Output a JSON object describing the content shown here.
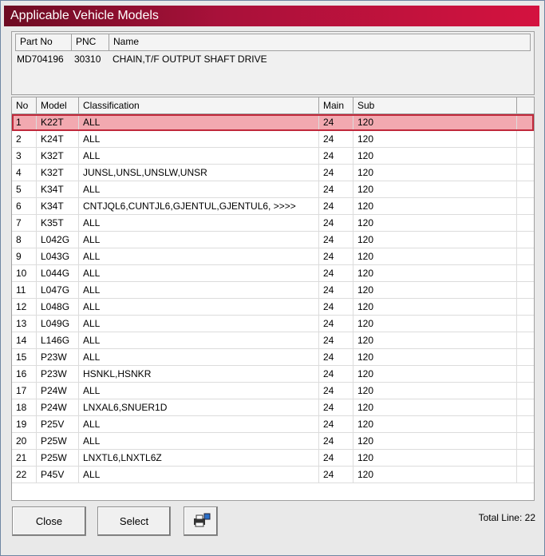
{
  "window": {
    "title": "Applicable Vehicle Models"
  },
  "part_panel": {
    "headers": [
      "Part No",
      "PNC",
      "Name"
    ],
    "row": [
      "MD704196",
      "30310",
      "CHAIN,T/F OUTPUT SHAFT DRIVE"
    ]
  },
  "grid": {
    "headers": [
      "No",
      "Model",
      "Classification",
      "Main",
      "Sub"
    ],
    "selected_row": 1,
    "rows": [
      [
        "1",
        "K22T",
        "ALL",
        "24",
        "120"
      ],
      [
        "2",
        "K24T",
        "ALL",
        "24",
        "120"
      ],
      [
        "3",
        "K32T",
        "ALL",
        "24",
        "120"
      ],
      [
        "4",
        "K32T",
        "JUNSL,UNSL,UNSLW,UNSR",
        "24",
        "120"
      ],
      [
        "5",
        "K34T",
        "ALL",
        "24",
        "120"
      ],
      [
        "6",
        "K34T",
        "CNTJQL6,CUNTJL6,GJENTUL,GJENTUL6,  >>>>",
        "24",
        "120"
      ],
      [
        "7",
        "K35T",
        "ALL",
        "24",
        "120"
      ],
      [
        "8",
        "L042G",
        "ALL",
        "24",
        "120"
      ],
      [
        "9",
        "L043G",
        "ALL",
        "24",
        "120"
      ],
      [
        "10",
        "L044G",
        "ALL",
        "24",
        "120"
      ],
      [
        "11",
        "L047G",
        "ALL",
        "24",
        "120"
      ],
      [
        "12",
        "L048G",
        "ALL",
        "24",
        "120"
      ],
      [
        "13",
        "L049G",
        "ALL",
        "24",
        "120"
      ],
      [
        "14",
        "L146G",
        "ALL",
        "24",
        "120"
      ],
      [
        "15",
        "P23W",
        "ALL",
        "24",
        "120"
      ],
      [
        "16",
        "P23W",
        "HSNKL,HSNKR",
        "24",
        "120"
      ],
      [
        "17",
        "P24W",
        "ALL",
        "24",
        "120"
      ],
      [
        "18",
        "P24W",
        "LNXAL6,SNUER1D",
        "24",
        "120"
      ],
      [
        "19",
        "P25V",
        "ALL",
        "24",
        "120"
      ],
      [
        "20",
        "P25W",
        "ALL",
        "24",
        "120"
      ],
      [
        "21",
        "P25W",
        "LNXTL6,LNXTL6Z",
        "24",
        "120"
      ],
      [
        "22",
        "P45V",
        "ALL",
        "24",
        "120"
      ]
    ]
  },
  "footer": {
    "close_label": "Close",
    "select_label": "Select",
    "print_icon": "printer-icon",
    "total_line": "Total Line: 22"
  },
  "colors": {
    "title_start": "#6d0b22",
    "title_end": "#d4123f",
    "selection": "#f2a9b0",
    "selection_border": "#c0283a"
  }
}
